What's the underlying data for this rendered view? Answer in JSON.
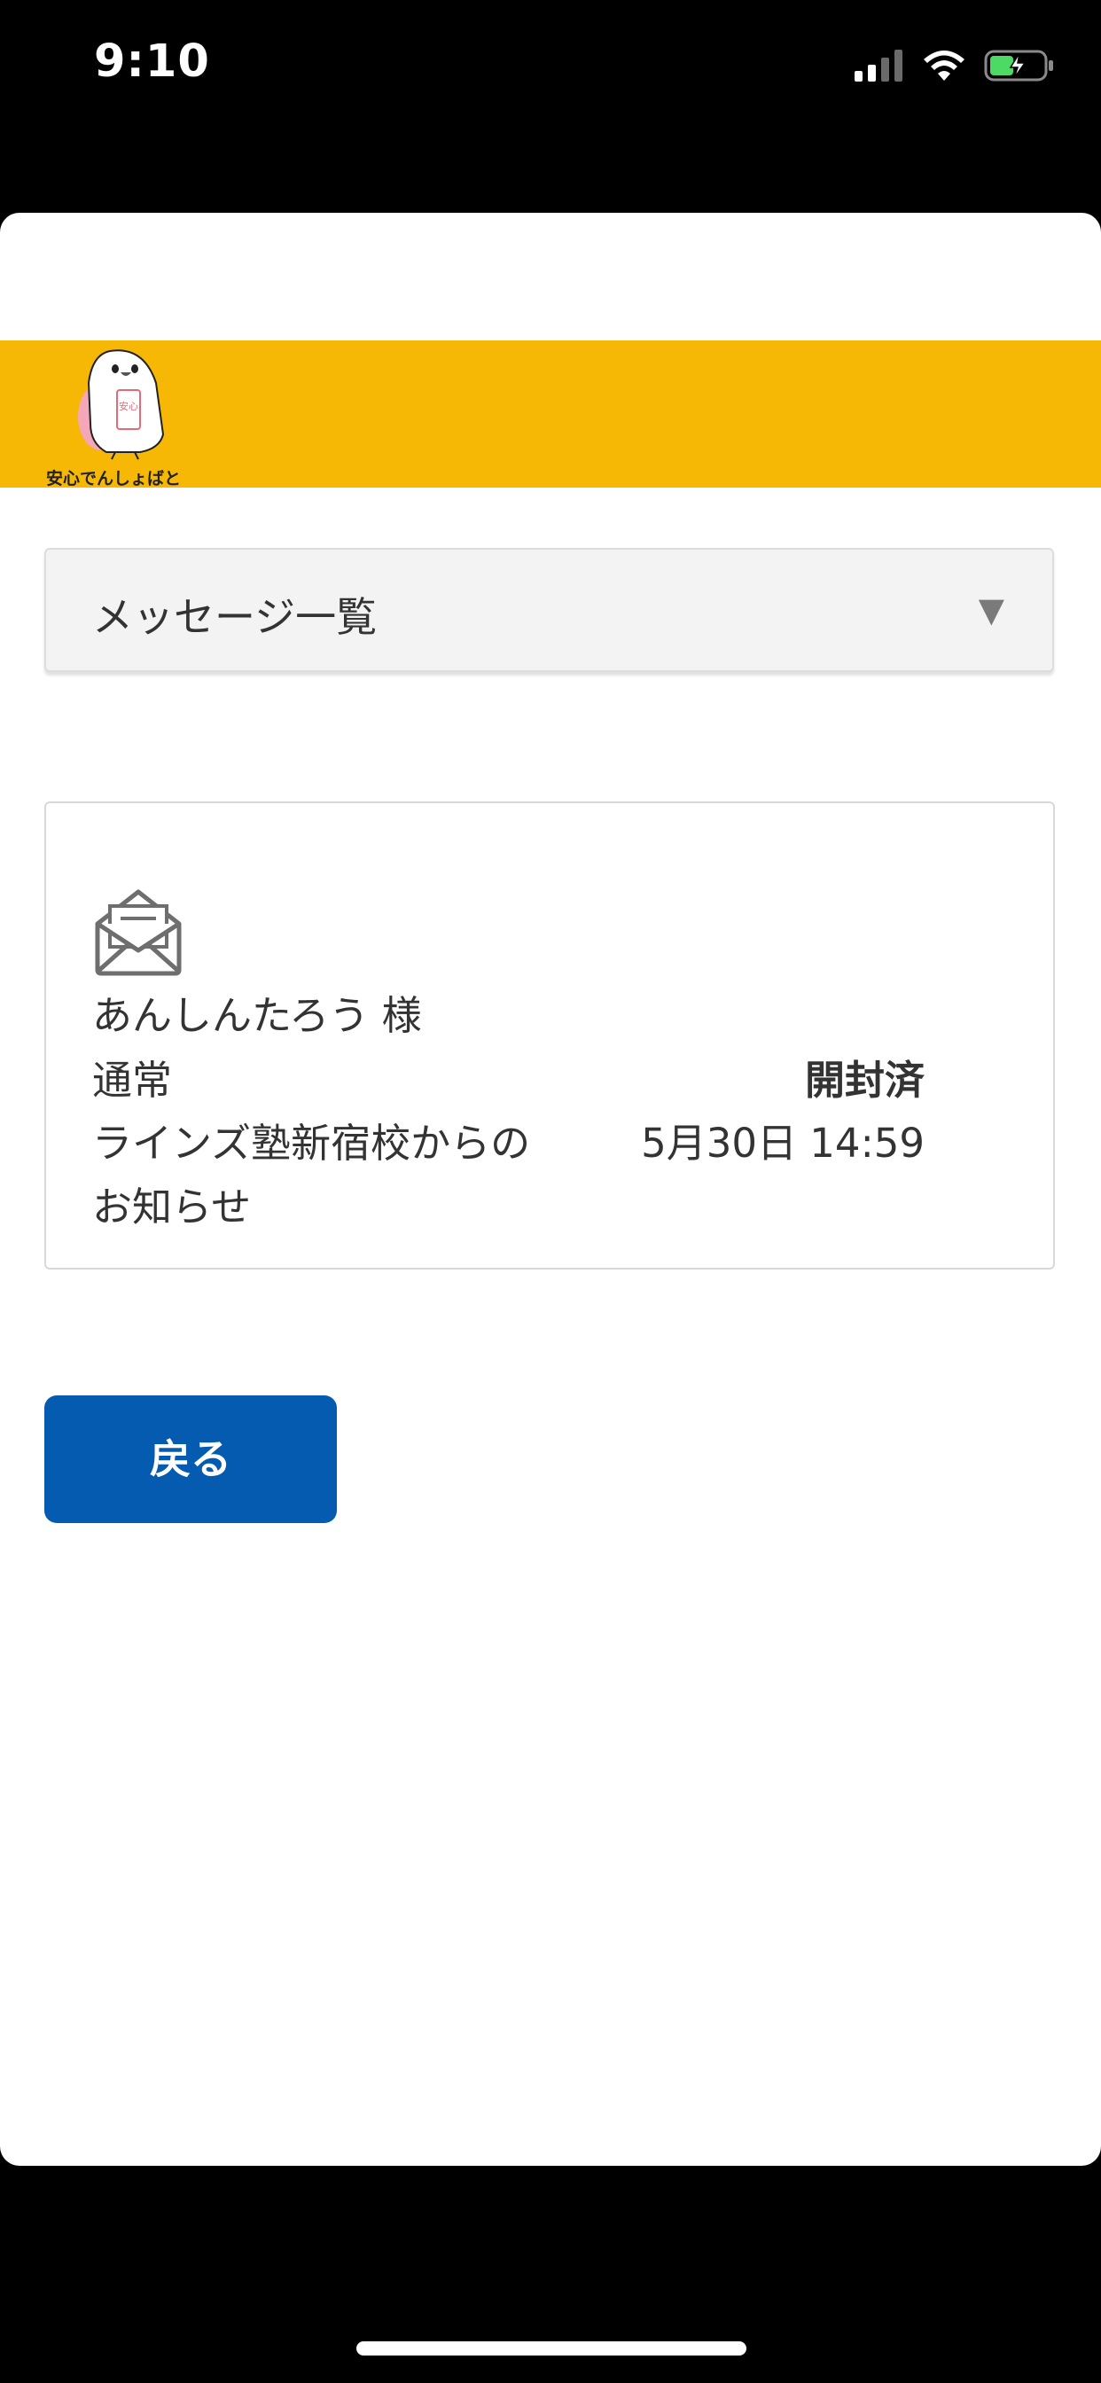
{
  "status_bar": {
    "time": "9:10",
    "signal_icon": "cellular-signal-icon",
    "wifi_icon": "wifi-icon",
    "battery_icon": "battery-charging-icon"
  },
  "brand": {
    "logo_text": "安心でんしょばと",
    "badge_text": "安心",
    "color": "#f6b705"
  },
  "select": {
    "selected": "メッセージ一覧",
    "arrow": "▼"
  },
  "message": {
    "icon": "open-envelope-icon",
    "recipient": "あんしんたろう 様",
    "priority": "通常",
    "status": "開封済",
    "subject": "ラインズ塾新宿校からのお知らせ",
    "date": "5月30日 14:59"
  },
  "back_button": {
    "label": "戻る",
    "color": "#055bb0"
  }
}
